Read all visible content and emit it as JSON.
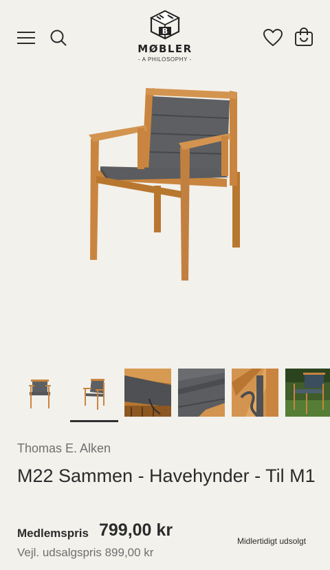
{
  "header": {
    "logo_name": "MØBLER",
    "logo_tagline": "- A PHILOSOPHY -",
    "icons": [
      "menu-icon",
      "search-icon",
      "heart-icon",
      "bag-icon"
    ]
  },
  "gallery": {
    "thumbnail_count": 6,
    "active_index": 1
  },
  "product": {
    "brand": "Thomas E. Alken",
    "title": "M22 Sammen - Havehynder - Til M1",
    "member_label": "Medlemspris",
    "member_price": "799,00 kr",
    "stock_status": "Midlertidigt udsolgt",
    "rrp_label": "Vejl. udsalgspris",
    "rrp_price": "899,00 kr"
  },
  "colors": {
    "background": "#f2f1ec",
    "text": "#2b2b2b",
    "muted": "#6f6f6f",
    "teak": "#c9853f",
    "cushion": "#5b5d60"
  }
}
